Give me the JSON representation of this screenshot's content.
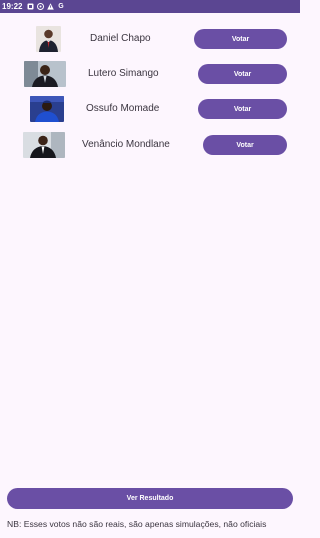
{
  "status_bar": {
    "time": "19:22",
    "icons": [
      "notification-icon",
      "whatsapp-icon",
      "warning-icon",
      "google-icon"
    ]
  },
  "candidates": [
    {
      "name": "Daniel Chapo",
      "vote_label": "Votar"
    },
    {
      "name": "Lutero Simango",
      "vote_label": "Votar"
    },
    {
      "name": "Ossufo Momade",
      "vote_label": "Votar"
    },
    {
      "name": "Venâncio Mondlane",
      "vote_label": "Votar"
    }
  ],
  "results_button": {
    "label": "Ver Resultado"
  },
  "footnote": "NB: Esses votos não são reais, são apenas simulações, não oficiais",
  "colors": {
    "status_bar": "#5b4692",
    "button": "#6a4fa5",
    "background": "#fdf6fe"
  }
}
